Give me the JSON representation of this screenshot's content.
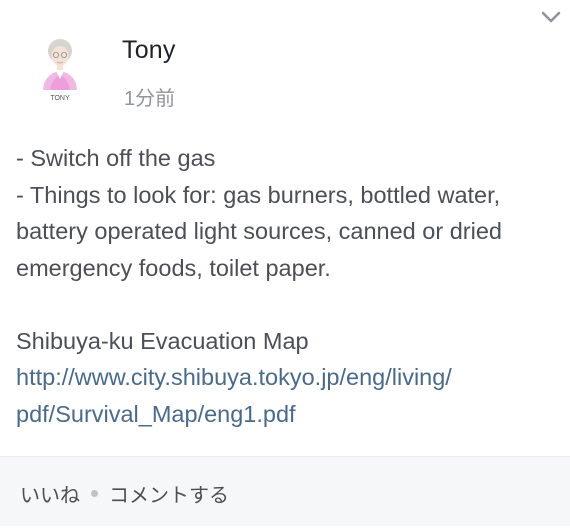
{
  "post": {
    "author": "Tony",
    "timestamp": "1分前",
    "avatar_label": "TONY",
    "lines": [
      "- Switch off the gas",
      "- Things to look for: gas burners, bottled water, battery operated light sources, canned or dried emergency foods, toilet paper."
    ],
    "map_title": "Shibuya-ku Evacuation Map",
    "link": "http://www.city.shibuya.tokyo.jp/eng/living/pdf/Survival_Map/eng1.pdf",
    "link_line1": "http://www.city.shibuya.tokyo.jp/eng/living/",
    "link_line2": "pdf/Survival_Map/eng1.pdf"
  },
  "actions": {
    "like": "いいね",
    "comment": "コメントする"
  },
  "icons": {
    "menu": "chevron-down-icon",
    "avatar": "avatar-illustration"
  }
}
